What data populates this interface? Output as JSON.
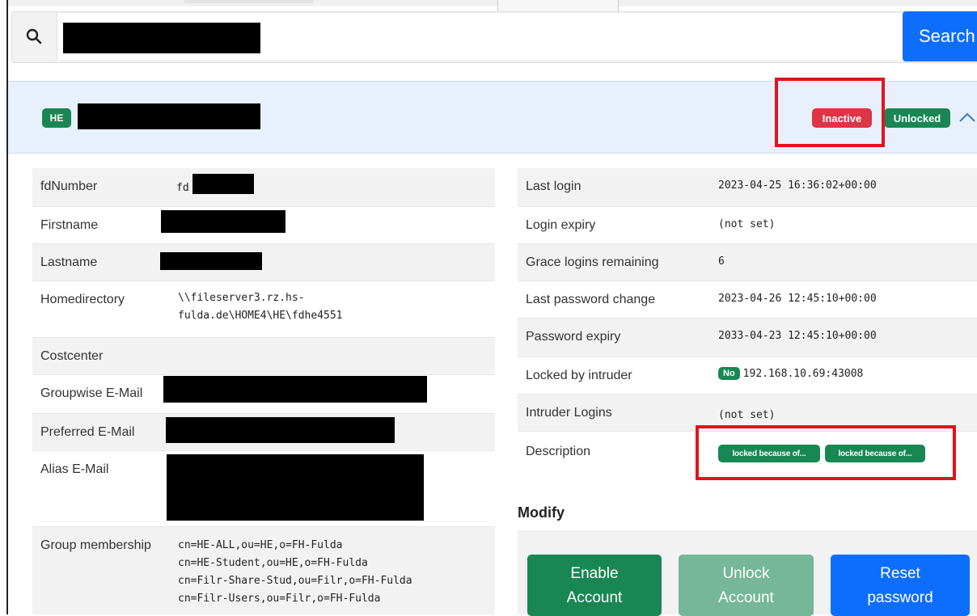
{
  "search": {
    "button_label": "Search"
  },
  "account": {
    "group_badge": "HE",
    "status_badge": "Inactive",
    "lock_badge": "Unlocked"
  },
  "details_left": [
    {
      "label": "fdNumber",
      "value": "fd"
    },
    {
      "label": "Firstname",
      "value": ""
    },
    {
      "label": "Lastname",
      "value": ""
    },
    {
      "label": "Homedirectory",
      "value_lines": [
        "\\\\fileserver3.rz.hs-",
        "fulda.de\\HOME4\\HE\\fdhe4551"
      ]
    },
    {
      "label": "Costcenter",
      "value": ""
    },
    {
      "label": "Groupwise E-Mail",
      "value": ""
    },
    {
      "label": "Preferred E-Mail",
      "value": ""
    },
    {
      "label": "Alias E-Mail",
      "value": ""
    },
    {
      "label": "Group membership",
      "value_lines": [
        "cn=HE-ALL,ou=HE,o=FH-Fulda",
        "cn=HE-Student,ou=HE,o=FH-Fulda",
        "cn=Filr-Share-Stud,ou=Filr,o=FH-Fulda",
        "cn=Filr-Users,ou=Filr,o=FH-Fulda"
      ]
    }
  ],
  "details_right": [
    {
      "label": "Last login",
      "value": "2023-04-25 16:36:02+00:00"
    },
    {
      "label": "Login expiry",
      "value": "(not set)"
    },
    {
      "label": "Grace logins remaining",
      "value": "6"
    },
    {
      "label": "Last password change",
      "value": "2023-04-26 12:45:10+00:00"
    },
    {
      "label": "Password expiry",
      "value": "2033-04-23 12:45:10+00:00"
    },
    {
      "label": "Locked by intruder",
      "badge": "No",
      "value": "192.168.10.69:43008"
    },
    {
      "label": "Intruder Logins",
      "value": "(not set)"
    },
    {
      "label": "Description",
      "badges": [
        "locked because of...",
        "locked because of..."
      ]
    }
  ],
  "modify": {
    "title": "Modify",
    "buttons": [
      {
        "line1": "Enable",
        "line2": "Account"
      },
      {
        "line1": "Unlock",
        "line2": "Account"
      },
      {
        "line1": "Reset",
        "line2": "password"
      }
    ]
  },
  "colors": {
    "primary": "#0d6efd",
    "success": "#198754",
    "danger": "#dc3545",
    "highlight": "#e0141e",
    "header_bg": "#e8f0fb"
  }
}
